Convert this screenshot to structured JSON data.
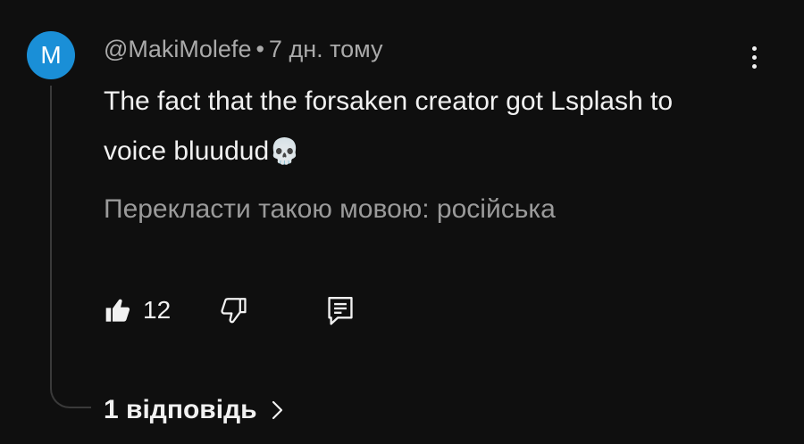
{
  "comment": {
    "avatar_letter": "M",
    "avatar_color": "#1a8fd7",
    "author": "@MakiMolefe",
    "separator": "•",
    "time": "7 дн. тому",
    "text": "The fact that the forsaken creator got Lsplash to voice bluudud",
    "text_emoji": "💀",
    "translate_label": "Перекласти такою мовою: російська",
    "like_count": "12",
    "replies_label": "1 відповідь"
  },
  "icons": {
    "more": "more-vertical-icon",
    "like": "thumbs-up-filled-icon",
    "dislike": "thumbs-down-icon",
    "reply": "reply-comment-icon",
    "chevron": "chevron-right-icon"
  },
  "colors": {
    "background": "#0f0f0f",
    "primary_text": "#f1f1f1",
    "secondary_text": "#aaaaaa"
  }
}
